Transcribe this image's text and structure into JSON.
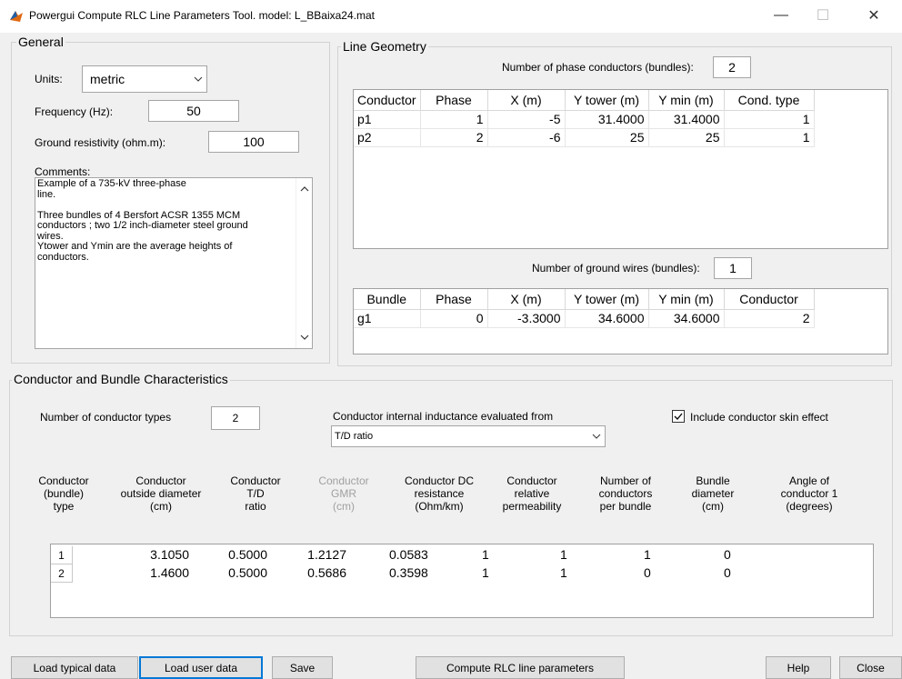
{
  "window": {
    "title": "Powergui Compute RLC Line Parameters Tool.  model: L_BBaixa24.mat",
    "minimize": "—",
    "maximize": "☐",
    "close": "✕"
  },
  "general": {
    "title": "General",
    "units_label": "Units:",
    "units_value": "metric",
    "frequency_label": "Frequency (Hz):",
    "frequency_value": "50",
    "ground_label": "Ground resistivity (ohm.m):",
    "ground_value": "100",
    "comments_label": "Comments:",
    "comments_lines": [
      "Example of a 735-kV three-phase",
      "line.",
      "",
      "Three bundles of 4 Bersfort ACSR 1355 MCM",
      "conductors ; two 1/2 inch-diameter steel ground",
      "wires.",
      "Ytower and Ymin are the average heights of",
      "conductors."
    ]
  },
  "geometry": {
    "title": "Line Geometry",
    "phase_count_label": "Number of phase conductors (bundles):",
    "phase_count_value": "2",
    "phase_headers": [
      "Conductor",
      "Phase",
      "X (m)",
      "Y tower (m)",
      "Y min (m)",
      "Cond. type"
    ],
    "phase_rows": [
      [
        "p1",
        "1",
        "-5",
        "31.4000",
        "31.4000",
        "1"
      ],
      [
        "p2",
        "2",
        "-6",
        "25",
        "25",
        "1"
      ]
    ],
    "ground_count_label": "Number of ground wires (bundles):",
    "ground_count_value": "1",
    "ground_headers": [
      "Bundle",
      "Phase",
      "X (m)",
      "Y tower (m)",
      "Y min (m)",
      "Conductor"
    ],
    "ground_rows": [
      [
        "g1",
        "0",
        "-3.3000",
        "34.6000",
        "34.6000",
        "2"
      ]
    ]
  },
  "characteristics": {
    "title": "Conductor and Bundle Characteristics",
    "types_label": "Number of conductor types",
    "types_value": "2",
    "inductance_label": "Conductor internal inductance evaluated from",
    "inductance_value": "T/D ratio",
    "skin_label": "Include conductor skin effect",
    "skin_checked": true,
    "headers": [
      "Conductor\n(bundle)\ntype",
      "Conductor\noutside diameter\n(cm)",
      "Conductor\nT/D\nratio",
      "Conductor\nGMR\n(cm)",
      "Conductor DC\nresistance\n(Ohm/km)",
      "Conductor\nrelative\npermeability",
      "Number of\nconductors\nper bundle",
      "Bundle\ndiameter\n(cm)",
      "Angle of\nconductor 1\n(degrees)"
    ],
    "rows": [
      [
        "1",
        "3.1050",
        "0.5000",
        "1.2127",
        "0.0583",
        "1",
        "1",
        "1",
        "0"
      ],
      [
        "2",
        "1.4600",
        "0.5000",
        "0.5686",
        "0.3598",
        "1",
        "1",
        "0",
        "0"
      ]
    ]
  },
  "buttons": {
    "load_typical": "Load typical data",
    "load_user": "Load user data",
    "save": "Save",
    "compute": "Compute RLC line parameters",
    "help": "Help",
    "close": "Close"
  }
}
